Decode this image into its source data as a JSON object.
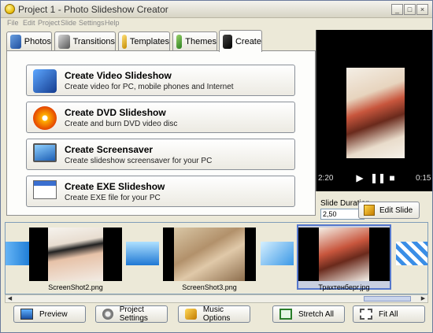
{
  "window": {
    "title": "Project 1 - Photo Slideshow Creator"
  },
  "menu": [
    "File",
    "Edit",
    "Project",
    "Slide",
    "Settings",
    "Help"
  ],
  "tabs": [
    {
      "label": "Photos",
      "icon": "photos-icon",
      "active": false
    },
    {
      "label": "Transitions",
      "icon": "transitions-icon",
      "active": false
    },
    {
      "label": "Templates",
      "icon": "templates-icon",
      "active": false
    },
    {
      "label": "Themes",
      "icon": "themes-icon",
      "active": false
    },
    {
      "label": "Create",
      "icon": "create-icon",
      "active": true
    }
  ],
  "create_options": [
    {
      "title": "Create Video Slideshow",
      "desc": "Create video for PC, mobile phones and Internet",
      "icon": "video-icon"
    },
    {
      "title": "Create DVD Slideshow",
      "desc": "Create and burn DVD video disc",
      "icon": "dvd-icon"
    },
    {
      "title": "Create Screensaver",
      "desc": "Create slideshow screensaver for your PC",
      "icon": "monitor-icon"
    },
    {
      "title": "Create EXE Slideshow",
      "desc": "Create EXE file for your PC",
      "icon": "exe-window-icon"
    }
  ],
  "player": {
    "time_left": "2:20",
    "time_right": "0:15"
  },
  "slide": {
    "label": "Slide Duration",
    "duration": "2,50",
    "edit_label": "Edit Slide"
  },
  "filmstrip": [
    {
      "caption": "ScreenShot2.png"
    },
    {
      "caption": "ScreenShot3.png"
    },
    {
      "caption": "Трахтенберг.jpg",
      "selected": true
    }
  ],
  "bottom_buttons": [
    {
      "label": "Preview",
      "icon": "monitor-icon"
    },
    {
      "label": "Project Settings",
      "icon": "gear-icon"
    },
    {
      "label": "Music Options",
      "icon": "music-icon"
    },
    {
      "label": "Stretch All",
      "icon": "stretch-icon"
    },
    {
      "label": "Fit All",
      "icon": "fit-icon"
    }
  ]
}
